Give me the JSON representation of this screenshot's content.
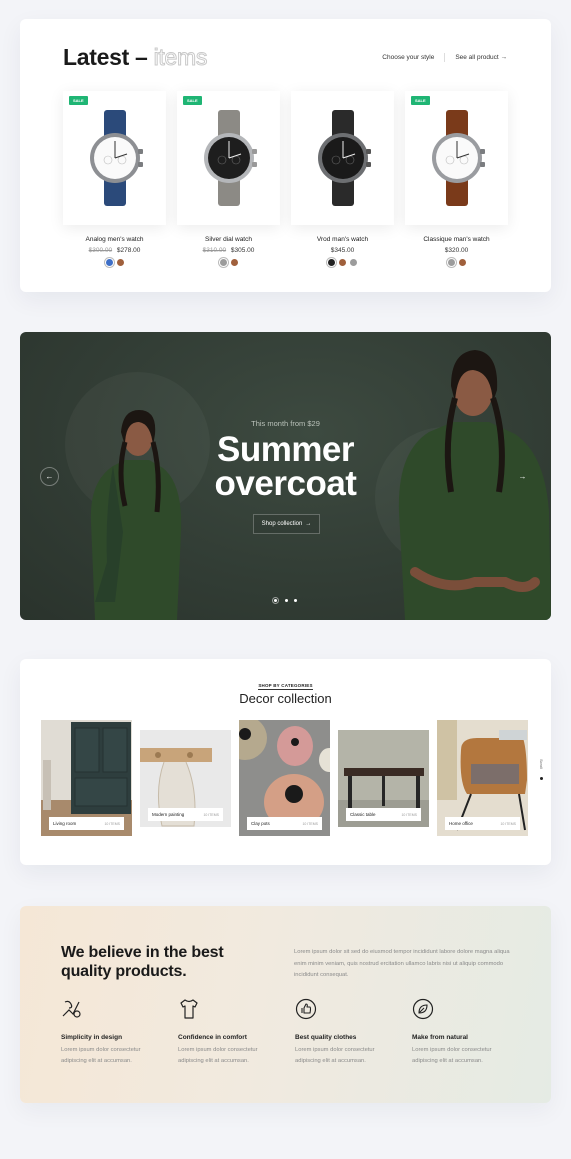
{
  "latest": {
    "title_main": "Latest –",
    "title_outline": "items",
    "choose_style": "Choose your style",
    "see_all": "See all product",
    "sale_label": "SALE",
    "products": [
      {
        "name": "Analog men's watch",
        "old_price": "$300.00",
        "price": "$278.00",
        "sale": true,
        "strap": "#2b4a7a",
        "dial": "white",
        "swatches": [
          "#3e6fc7",
          "#a0603c"
        ]
      },
      {
        "name": "Silver dial watch",
        "old_price": "$310.00",
        "price": "$305.00",
        "sale": true,
        "strap": "#8c8a85",
        "dial": "black",
        "swatches": [
          "#9c9c9c",
          "#a0603c"
        ]
      },
      {
        "name": "Vrod man's watch",
        "old_price": "",
        "price": "$345.00",
        "sale": false,
        "strap": "#2a2a2a",
        "dial": "black",
        "swatches": [
          "#222222",
          "#a0603c",
          "#9c9c9c"
        ]
      },
      {
        "name": "Classique man's watch",
        "old_price": "",
        "price": "$320.00",
        "sale": true,
        "strap": "#7a3a1a",
        "dial": "white",
        "swatches": [
          "#9c9c9c",
          "#a0603c"
        ]
      }
    ]
  },
  "hero": {
    "subtitle": "This month from $29",
    "title_line1": "Summer",
    "title_line2": "overcoat",
    "button": "Shop collection",
    "prev_icon": "arrow-left-icon",
    "next_icon": "arrow-right-icon"
  },
  "decor": {
    "kicker": "SHOP BY CATEGORIES",
    "title": "Decor collection",
    "scroll_label": "Scroll",
    "items": [
      {
        "label": "Living room",
        "count": "10 ITEMS"
      },
      {
        "label": "Modern painting",
        "count": "10 ITEMS"
      },
      {
        "label": "Clay pots",
        "count": "10 ITEMS"
      },
      {
        "label": "Classic table",
        "count": "10 ITEMS"
      },
      {
        "label": "Home office",
        "count": "10 ITEMS"
      }
    ]
  },
  "quality": {
    "title_line1": "We believe in the best",
    "title_line2": "quality products.",
    "paragraph": "Lorem ipsum dolor sit sed do eiusmod tempor incididunt labore dolore magna aliqua enim minim veniam, quis nostrud ercitation ullamco labris nisi ut aliquip commodo incididunt consequat.",
    "features": [
      {
        "title": "Simplicity in design",
        "desc": "Lorem ipsum dolor consectetur adipiscing elit at accumsan.",
        "icon": "design-icon"
      },
      {
        "title": "Confidence in comfort",
        "desc": "Lorem ipsum dolor consectetur adipiscing elit at accumsan.",
        "icon": "tshirt-icon"
      },
      {
        "title": "Best quality clothes",
        "desc": "Lorem ipsum dolor consectetur adipiscing elit at accumsan.",
        "icon": "thumbs-up-icon"
      },
      {
        "title": "Make from natural",
        "desc": "Lorem ipsum dolor consectetur adipiscing elit at accumsan.",
        "icon": "leaf-icon"
      }
    ]
  }
}
